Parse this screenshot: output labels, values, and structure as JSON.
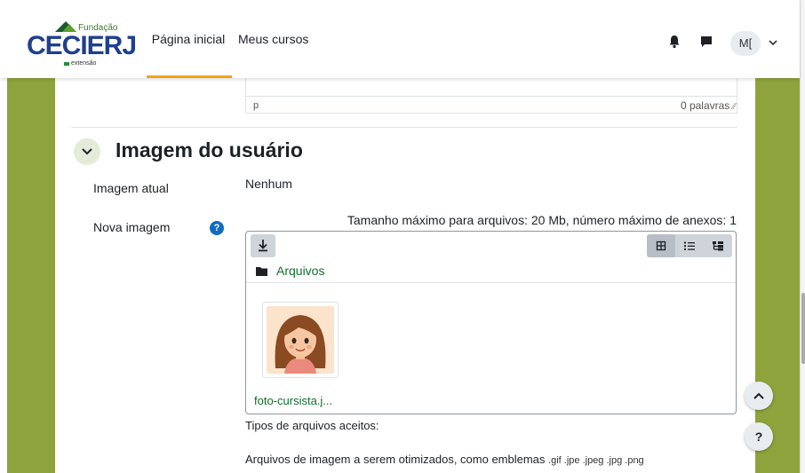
{
  "header": {
    "logo": {
      "small": "Fundação",
      "brand": "CECIERJ",
      "tag": "extensão"
    },
    "nav": [
      {
        "label": "Página inicial"
      },
      {
        "label": "Meus cursos"
      }
    ],
    "icons": [
      "bell-icon",
      "chat-icon"
    ],
    "user_initials": "M[",
    "accent_color": "#f0a21e"
  },
  "editor": {
    "path": "p",
    "word_count": "0 palavras"
  },
  "section": {
    "title": "Imagem do usuário",
    "current_image_label": "Imagem atual",
    "current_image_value": "Nenhum",
    "new_image_label": "Nova imagem",
    "help_glyph": "?"
  },
  "filepicker": {
    "max_info": "Tamanho máximo para arquivos: 20 Mb, número máximo de anexos: 1",
    "folder": "Arquivos",
    "file_name": "foto-cursista.j...",
    "views": [
      "icon-view",
      "list-view",
      "tree-view"
    ]
  },
  "accepted": {
    "label": "Tipos de arquivos aceitos:",
    "description": "Arquivos de imagem a serem otimizados, como emblemas",
    "extensions": ".gif .jpe .jpeg .jpg .png"
  },
  "floating": {
    "help_glyph": "?"
  },
  "colors": {
    "side_green": "#8ea33b",
    "link_green": "#0f6e2d",
    "brand_blue": "#1f3f8f",
    "help_blue": "#0f6cbf"
  }
}
